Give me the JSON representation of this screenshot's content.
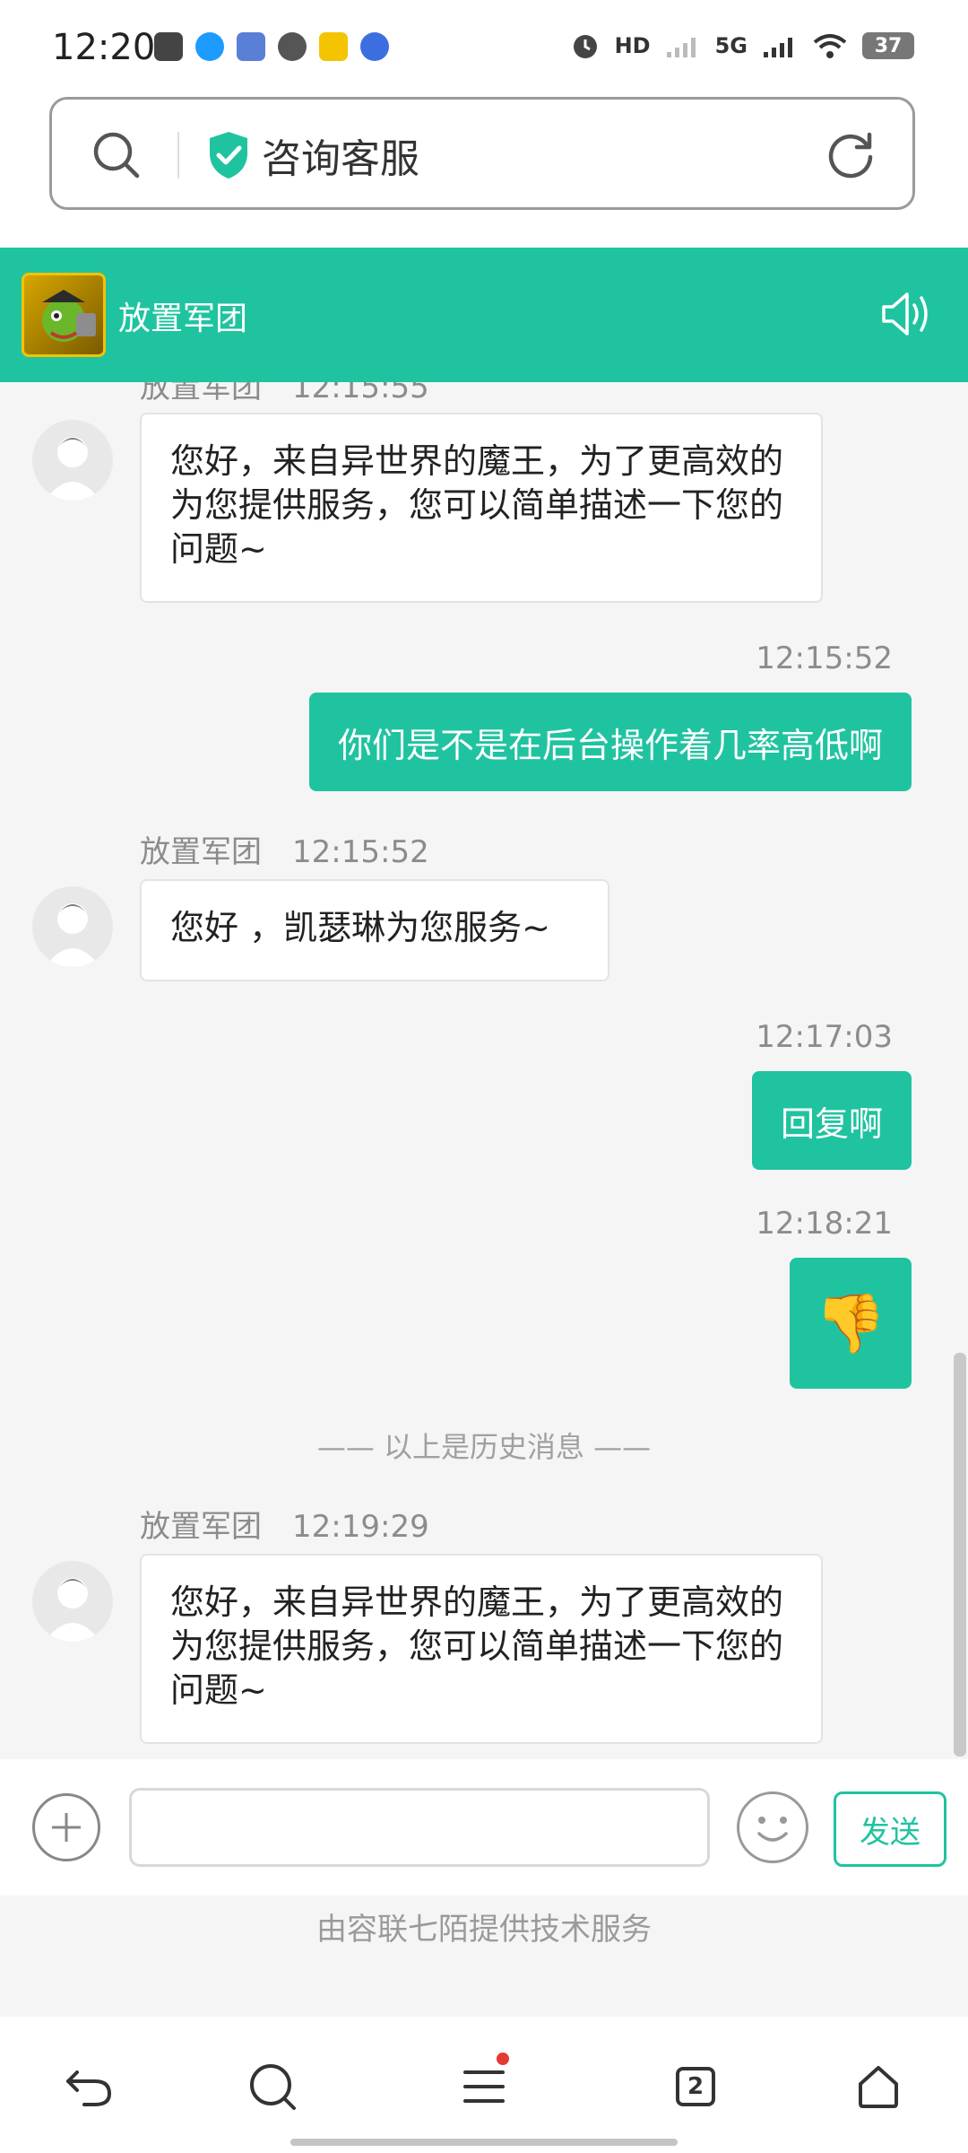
{
  "status_bar": {
    "time": "12:20",
    "hd_label": "HD",
    "signal_label": "5G",
    "battery": "37"
  },
  "browser": {
    "title": "咨询客服"
  },
  "chat_header": {
    "title": "放置军团"
  },
  "messages": {
    "partial_meta": {
      "sender": "放置军团",
      "time": "12:15:55"
    },
    "m1": {
      "text": "您好，来自异世界的魔王，为了更高效的为您提供服务，您可以简单描述一下您的问题~"
    },
    "m2": {
      "time": "12:15:52",
      "text": "你们是不是在后台操作着几率高低啊"
    },
    "m3": {
      "sender": "放置军团",
      "time": "12:15:52",
      "text": "您好 ，凯瑟琳为您服务~"
    },
    "m4": {
      "time": "12:17:03",
      "text": "回复啊"
    },
    "m5": {
      "time": "12:18:21",
      "emoji": "👎"
    },
    "history_label": "—— 以上是历史消息 ——",
    "m6": {
      "sender": "放置军团",
      "time": "12:19:29",
      "text": "您好，来自异世界的魔王，为了更高效的为您提供服务，您可以简单描述一下您的问题~"
    }
  },
  "input": {
    "value": "",
    "send_label": "发送"
  },
  "footer": {
    "credit": "由容联七陌提供技术服务"
  },
  "nav": {
    "tabs_count": "2"
  },
  "colors": {
    "accent": "#20c3a0",
    "bubble_border": "#e3e3e3",
    "notification": "#e53935"
  }
}
